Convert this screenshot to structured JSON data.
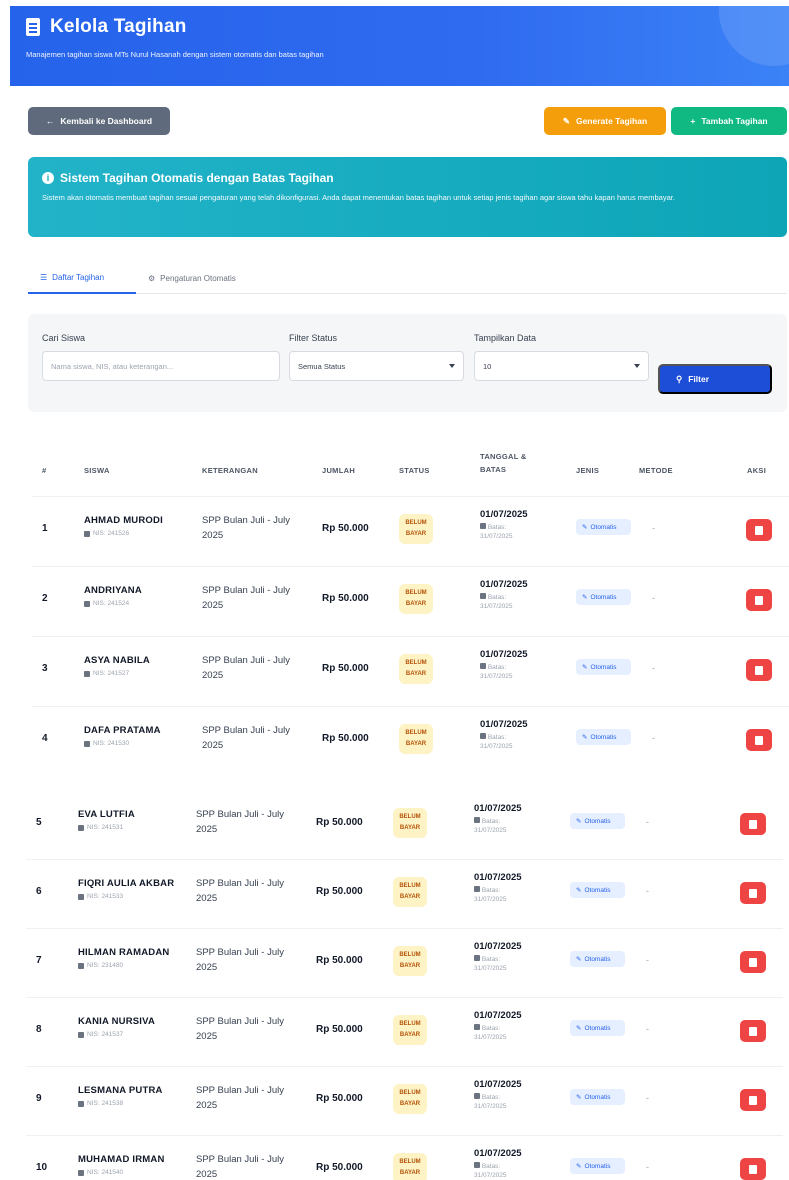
{
  "header": {
    "title": "Kelola Tagihan",
    "subtitle": "Manajemen tagihan siswa MTs Nurul Hasanah dengan sistem otomatis dan batas tagihan"
  },
  "toolbar": {
    "back_label": "Kembali ke Dashboard",
    "generate_label": "Generate Tagihan",
    "add_label": "Tambah Tagihan"
  },
  "banner": {
    "title": "Sistem Tagihan Otomatis dengan Batas Tagihan",
    "text": "Sistem akan otomatis membuat tagihan sesuai pengaturan yang telah dikonfigurasi. Anda dapat menentukan batas tagihan untuk setiap jenis tagihan agar siswa tahu kapan harus membayar."
  },
  "tabs": {
    "list_label": "Daftar Tagihan",
    "settings_label": "Pengaturan Otomatis"
  },
  "filters": {
    "search_label": "Cari Siswa",
    "search_placeholder": "Nama siswa, NIS, atau keterangan...",
    "status_label": "Filter Status",
    "status_value": "Semua Status",
    "show_label": "Tampilkan Data",
    "show_value": "10",
    "filter_button": "Filter"
  },
  "table": {
    "headers": {
      "num": "#",
      "siswa": "SISWA",
      "keterangan": "KETERANGAN",
      "jumlah": "JUMLAH",
      "status": "STATUS",
      "tanggal": "TANGGAL &",
      "tanggal2": "BATAS",
      "jenis": "JENIS",
      "metode": "METODE",
      "aksi": "AKSI"
    },
    "rows": [
      {
        "num": "1",
        "name": "AHMAD MURODI",
        "nis": "NIS: 241526",
        "ket": "SPP Bulan Juli - July 2025",
        "amount": "Rp 50.000",
        "status": "BELUM BAYAR",
        "date": "01/07/2025",
        "batas1": "Batas:",
        "batas2": "31/07/2025",
        "jenis": "Otomatis",
        "metode": "-"
      },
      {
        "num": "2",
        "name": "ANDRIYANA",
        "nis": "NIS: 241524",
        "ket": "SPP Bulan Juli - July 2025",
        "amount": "Rp 50.000",
        "status": "BELUM BAYAR",
        "date": "01/07/2025",
        "batas1": "Batas:",
        "batas2": "31/07/2025",
        "jenis": "Otomatis",
        "metode": "-"
      },
      {
        "num": "3",
        "name": "ASYA NABILA",
        "nis": "NIS: 241527",
        "ket": "SPP Bulan Juli - July 2025",
        "amount": "Rp 50.000",
        "status": "BELUM BAYAR",
        "date": "01/07/2025",
        "batas1": "Batas:",
        "batas2": "31/07/2025",
        "jenis": "Otomatis",
        "metode": "-"
      },
      {
        "num": "4",
        "name": "DAFA PRATAMA",
        "nis": "NIS: 241530",
        "ket": "SPP Bulan Juli - July 2025",
        "amount": "Rp 50.000",
        "status": "BELUM BAYAR",
        "date": "01/07/2025",
        "batas1": "Batas:",
        "batas2": "31/07/2025",
        "jenis": "Otomatis",
        "metode": "-"
      },
      {
        "num": "5",
        "name": "EVA LUTFIA",
        "nis": "NIS: 241531",
        "ket": "SPP Bulan Juli - July 2025",
        "amount": "Rp 50.000",
        "status": "BELUM BAYAR",
        "date": "01/07/2025",
        "batas1": "Batas:",
        "batas2": "31/07/2025",
        "jenis": "Otomatis",
        "metode": "-"
      },
      {
        "num": "6",
        "name": "FIQRI AULIA AKBAR",
        "nis": "NIS: 241533",
        "ket": "SPP Bulan Juli - July 2025",
        "amount": "Rp 50.000",
        "status": "BELUM BAYAR",
        "date": "01/07/2025",
        "batas1": "Batas:",
        "batas2": "31/07/2025",
        "jenis": "Otomatis",
        "metode": "-"
      },
      {
        "num": "7",
        "name": "HILMAN RAMADAN",
        "nis": "NIS: 231480",
        "ket": "SPP Bulan Juli - July 2025",
        "amount": "Rp 50.000",
        "status": "BELUM BAYAR",
        "date": "01/07/2025",
        "batas1": "Batas:",
        "batas2": "31/07/2025",
        "jenis": "Otomatis",
        "metode": "-"
      },
      {
        "num": "8",
        "name": "KANIA NURSIVA",
        "nis": "NIS: 241537",
        "ket": "SPP Bulan Juli - July 2025",
        "amount": "Rp 50.000",
        "status": "BELUM BAYAR",
        "date": "01/07/2025",
        "batas1": "Batas:",
        "batas2": "31/07/2025",
        "jenis": "Otomatis",
        "metode": "-"
      },
      {
        "num": "9",
        "name": "LESMANA PUTRA",
        "nis": "NIS: 241538",
        "ket": "SPP Bulan Juli - July 2025",
        "amount": "Rp 50.000",
        "status": "BELUM BAYAR",
        "date": "01/07/2025",
        "batas1": "Batas:",
        "batas2": "31/07/2025",
        "jenis": "Otomatis",
        "metode": "-"
      },
      {
        "num": "10",
        "name": "MUHAMAD IRMAN",
        "nis": "NIS: 241540",
        "ket": "SPP Bulan Juli - July 2025",
        "amount": "Rp 50.000",
        "status": "BELUM BAYAR",
        "date": "01/07/2025",
        "batas1": "Batas:",
        "batas2": "31/07/2025",
        "jenis": "Otomatis",
        "metode": "-"
      }
    ]
  },
  "colors": {
    "header_blue": "#2563eb",
    "back_gray": "#5f6b7c",
    "generate_orange": "#f59e0b",
    "add_green": "#10b981",
    "banner_teal": "#0ea5b7",
    "delete_red": "#ef4444",
    "badge_yellow": "#fdf3c4"
  },
  "icons": {
    "header": "document-icon",
    "back": "arrow-left-icon",
    "generate": "pencil-icon",
    "add": "plus-icon",
    "info": "info-icon",
    "list_tab": "list-icon",
    "settings_tab": "gear-icon",
    "filter": "search-icon",
    "delete": "trash-icon"
  }
}
